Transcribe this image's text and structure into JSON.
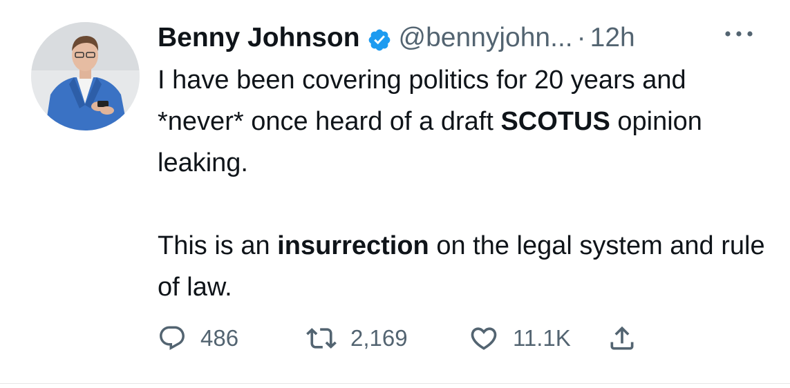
{
  "tweet": {
    "author": {
      "display_name": "Benny Johnson",
      "handle": "@bennyjohn...",
      "verified": true
    },
    "separator": "·",
    "time": "12h",
    "more_icon": "more-horizontal-icon",
    "text": {
      "line1_part1": "I have been covering politics for 20 years and *never* once heard of a draft ",
      "line1_bold": "SCOTUS",
      "line1_part2": " opinion leaking.",
      "line2_part1": "This is an ",
      "line2_bold": "insurrection",
      "line2_part2": " on the legal system and rule of law."
    },
    "actions": {
      "reply_count": "486",
      "retweet_count": "2,169",
      "like_count": "11.1K"
    }
  },
  "colors": {
    "text_primary": "#0f1419",
    "text_secondary": "#536471",
    "verified_blue": "#1d9bf0",
    "background": "#ffffff"
  }
}
